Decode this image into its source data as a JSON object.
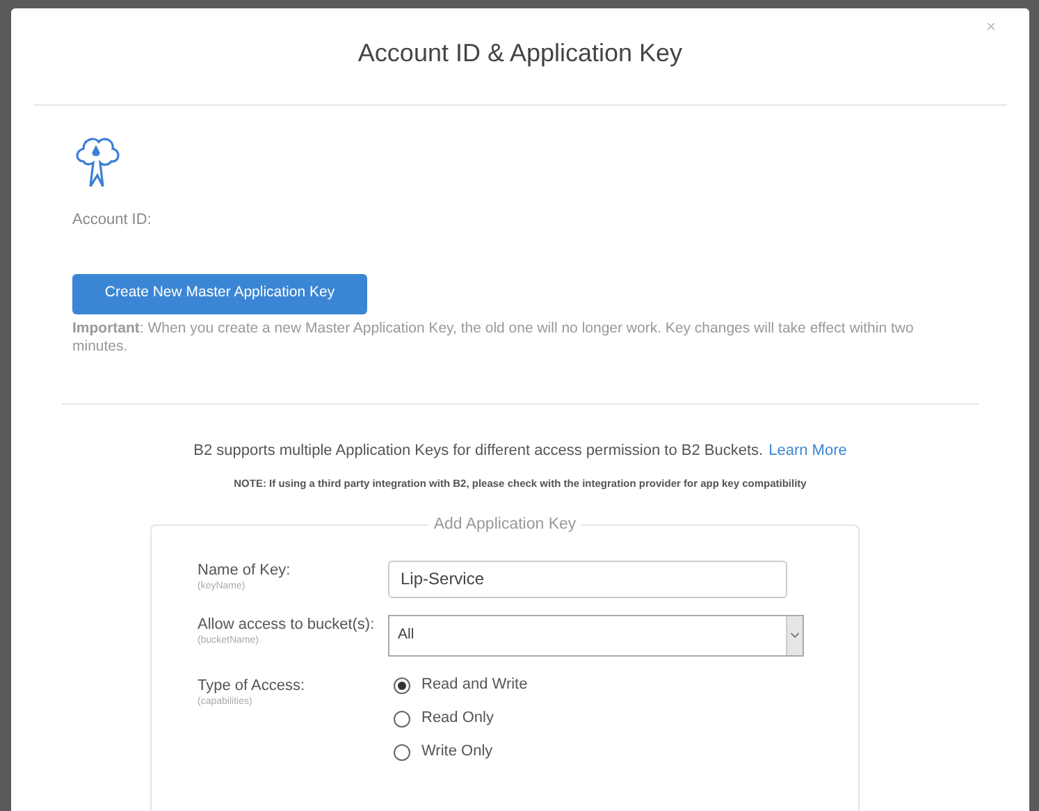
{
  "dialog": {
    "title": "Account ID & Application Key",
    "close": "×"
  },
  "account": {
    "label": "Account ID:"
  },
  "master_button": "Create New Master Application Key",
  "important": "**Important**: When you create a new Master Application Key, the old one will no longer work. Key changes will take effect within two minutes.",
  "info": {
    "text": "B2 supports multiple Application Keys for different access permission to B2 Buckets.",
    "link": "Learn More"
  },
  "note": "NOTE: If using a third party integration with B2, please check with the integration provider for app key compatibility",
  "form": {
    "legend": "Add Application Key",
    "name_field": {
      "label": "Name of Key:",
      "hint": "(keyName)",
      "value": "Lip-Service"
    },
    "bucket_field": {
      "label": "Allow access to bucket(s):",
      "hint": "(bucketName)",
      "value": "All"
    },
    "access": {
      "label": "Type of Access:",
      "hint": "(capabilities)",
      "options": [
        {
          "label": "Read and Write",
          "selected": true
        },
        {
          "label": "Read Only",
          "selected": false
        },
        {
          "label": "Write Only",
          "selected": false
        }
      ]
    }
  }
}
